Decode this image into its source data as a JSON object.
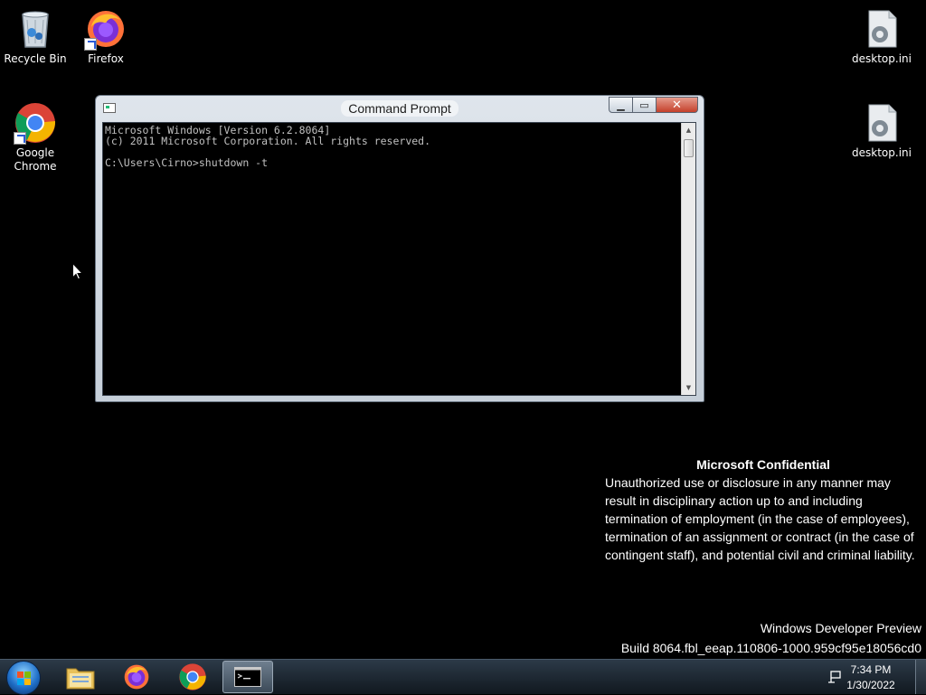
{
  "desktop": {
    "icons": [
      {
        "label": "Recycle Bin"
      },
      {
        "label": "Firefox"
      },
      {
        "label": "Google Chrome"
      },
      {
        "label": "desktop.ini"
      },
      {
        "label": "desktop.ini"
      }
    ]
  },
  "cmd": {
    "title": "Command Prompt",
    "lines": [
      "Microsoft Windows [Version 6.2.8064]",
      "(c) 2011 Microsoft Corporation. All rights reserved.",
      "",
      "C:\\Users\\Cirno>shutdown -t"
    ]
  },
  "notice": {
    "title": "Microsoft Confidential",
    "body": "Unauthorized use or disclosure in any manner may result in disciplinary action up to and including termination of employment (in the case of employees), termination of an assignment or contract (in the case of contingent staff), and potential civil and criminal liability."
  },
  "build": {
    "line1": "Windows Developer Preview",
    "line2": "Build 8064.fbl_eeap.110806-1000.959cf95e18056cd0"
  },
  "taskbar": {
    "items": [
      "start-button",
      "file-explorer",
      "firefox",
      "chrome",
      "command-prompt"
    ],
    "clock_time": "7:34 PM",
    "clock_date": "1/30/2022"
  },
  "colors": {
    "desktop_bg": "#000000",
    "cmd_text": "#c0c0c0",
    "close_button": "#c4402b"
  }
}
